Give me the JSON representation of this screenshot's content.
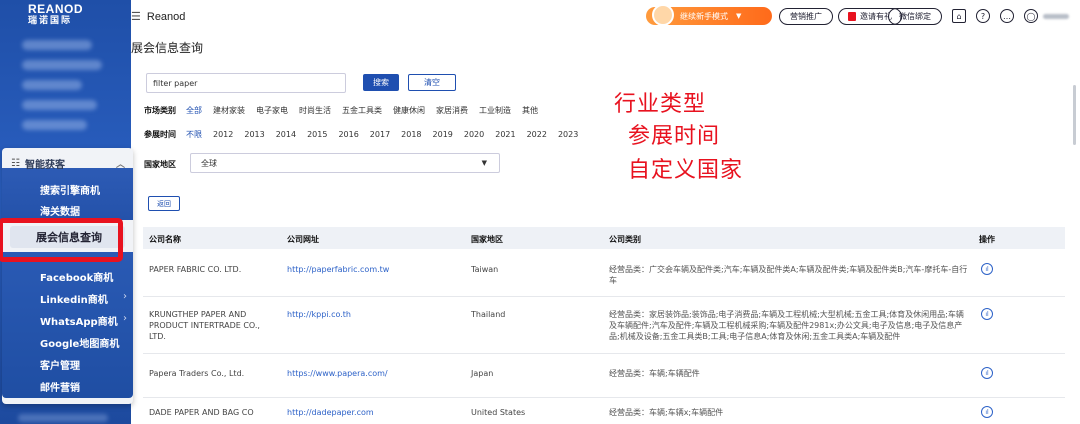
{
  "sidebar": {
    "logo_top": "REANOD",
    "logo_bottom": "瑞诺国际"
  },
  "menu": {
    "group_label": "智能获客",
    "items": [
      {
        "label": "搜索引擎商机"
      },
      {
        "label": "海关数据"
      },
      {
        "label": "展会信息查询"
      },
      {
        "label": "Facebook商机"
      },
      {
        "label": "Linkedin商机"
      },
      {
        "label": "WhatsApp商机"
      },
      {
        "label": "Google地图商机"
      },
      {
        "label": "客户管理"
      },
      {
        "label": "邮件营销"
      }
    ]
  },
  "topbar": {
    "brand": "Reanod",
    "newbie_mode": "继续新手模式",
    "marketing": "营销推广",
    "invite": "邀请有礼",
    "wechat": "微信绑定"
  },
  "page": {
    "title": "展会信息查询"
  },
  "search": {
    "value": "filter paper",
    "search_btn": "搜索",
    "clear_btn": "清空"
  },
  "filters": {
    "market_label": "市场类别",
    "market_options": [
      "全部",
      "建材家装",
      "电子家电",
      "时尚生活",
      "五金工具类",
      "健康休闲",
      "家居消费",
      "工业制造",
      "其他"
    ],
    "time_label": "参展时间",
    "time_options": [
      "不限",
      "2012",
      "2013",
      "2014",
      "2015",
      "2016",
      "2017",
      "2018",
      "2019",
      "2020",
      "2021",
      "2022",
      "2023"
    ],
    "region_label": "国家地区",
    "region_value": "全球",
    "back_btn": "返回"
  },
  "annotations": {
    "industry": "行业类型",
    "time": "参展时间",
    "country": "自定义国家"
  },
  "table": {
    "headers": {
      "name": "公司名称",
      "url": "公司网址",
      "country": "国家地区",
      "category": "公司类别",
      "action": "操作"
    },
    "rows": [
      {
        "name": "PAPER FABRIC CO. LTD.",
        "url": "http://paperfabric.com.tw",
        "country": "Taiwan",
        "category": "经营品类：广交会车辆及配件类;汽车;车辆及配件类A;车辆及配件类;车辆及配件类B;汽车-摩托车-自行车"
      },
      {
        "name": "KRUNGTHEP PAPER AND PRODUCT INTERTRADE CO., LTD.",
        "url": "http://kppi.co.th",
        "country": "Thailand",
        "category": "经营品类：家居装饰品;装饰品;电子消费品;车辆及工程机械;大型机械;五金工具;体育及休闲用品;车辆及车辆配件;汽车及配件;车辆及工程机械采购;车辆及配件2981x;办公文具;电子及信息;电子及信息产品;机械及设备;五金工具类B;工具;电子信息A;体育及休闲;五金工具类A;车辆及配件"
      },
      {
        "name": "Papera Traders Co., Ltd.",
        "url": "https://www.papera.com/",
        "country": "Japan",
        "category": "经营品类：车辆;车辆配件"
      },
      {
        "name": "DADE PAPER AND BAG CO",
        "url": "http://dadepaper.com",
        "country": "United States",
        "category": "经营品类：车辆;车辆x;车辆配件"
      }
    ]
  },
  "colors": {
    "primary": "#1f4fb0",
    "annotation_red": "#e8121f",
    "orange": "#ff7a22",
    "sidebar": "#2a5fc0"
  }
}
